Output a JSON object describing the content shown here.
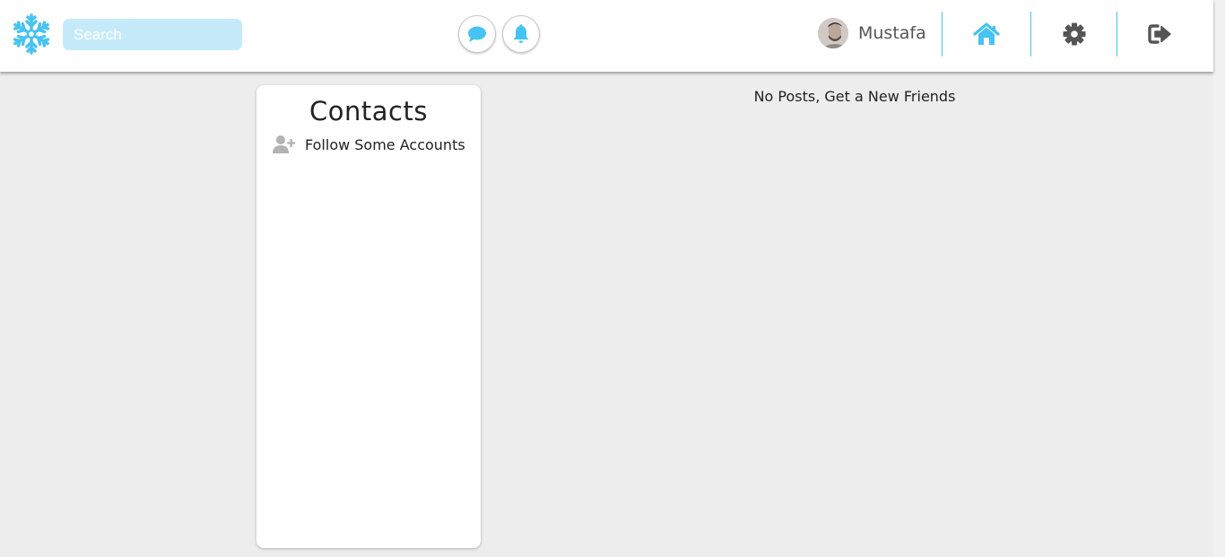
{
  "header": {
    "logo_icon": "snowflake-icon",
    "search": {
      "placeholder": "Search",
      "value": ""
    },
    "actions": [
      {
        "icon": "chat-bubble-icon"
      },
      {
        "icon": "bell-icon"
      }
    ],
    "user": {
      "name": "Mustafa",
      "avatar_icon": "avatar"
    },
    "nav": [
      {
        "icon": "home-icon",
        "color": "#45c3f2"
      },
      {
        "icon": "gear-icon",
        "color": "#555555"
      },
      {
        "icon": "sign-out-icon",
        "color": "#555555"
      }
    ],
    "accent_color": "#45c3f2"
  },
  "contacts": {
    "title": "Contacts",
    "follow_prompt": {
      "icon": "user-plus-icon",
      "label": "Follow Some Accounts"
    }
  },
  "feed": {
    "empty_message": "No Posts, Get a New Friends"
  }
}
